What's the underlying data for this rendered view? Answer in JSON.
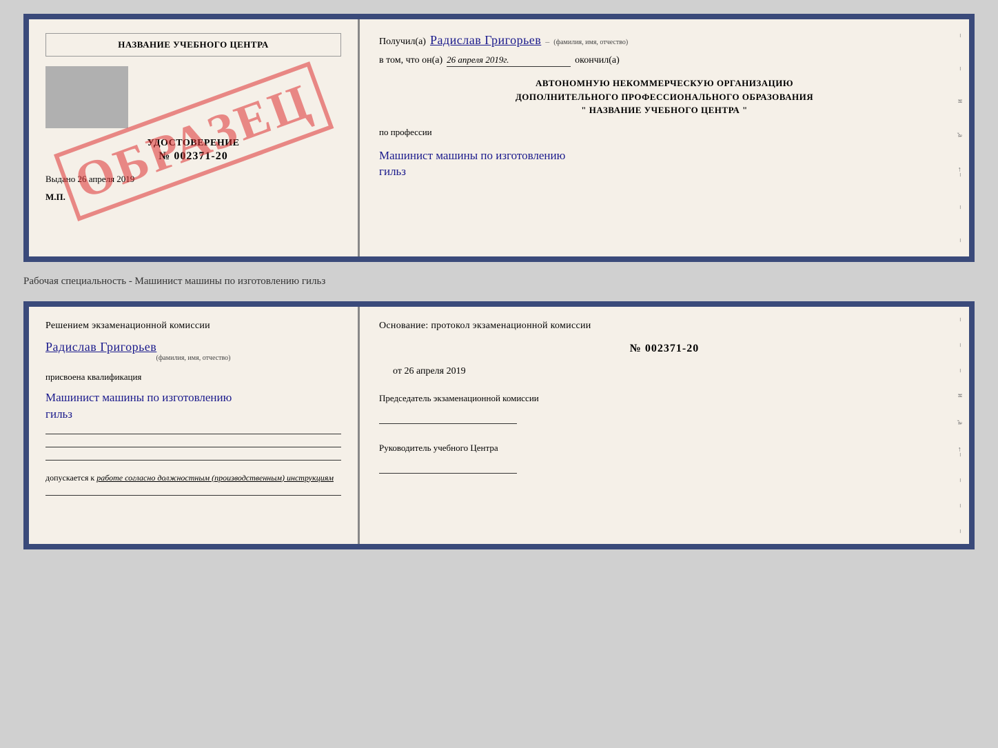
{
  "top_doc": {
    "left": {
      "center_name": "НАЗВАНИЕ УЧЕБНОГО ЦЕНТРА",
      "cert_label": "УДОСТОВЕРЕНИЕ",
      "cert_number": "№ 002371-20",
      "vydano_label": "Выдано",
      "vydano_date": "26 апреля 2019",
      "mp_label": "М.П.",
      "obrazec": "ОБРАЗЕЦ"
    },
    "right": {
      "poluchil_label": "Получил(а)",
      "recipient_name": "Радислав Григорьев",
      "name_sublabel": "(фамилия, имя, отчество)",
      "vtom_label": "в том, что он(а)",
      "completion_date": "26 апреля 2019г.",
      "okonchil_label": "окончил(а)",
      "org_line1": "АВТОНОМНУЮ НЕКОММЕРЧЕСКУЮ ОРГАНИЗАЦИЮ",
      "org_line2": "ДОПОЛНИТЕЛЬНОГО ПРОФЕССИОНАЛЬНОГО ОБРАЗОВАНИЯ",
      "org_quote1": "\"",
      "org_center_name": "НАЗВАНИЕ УЧЕБНОГО ЦЕНТРА",
      "org_quote2": "\"",
      "po_professii_label": "по профессии",
      "profession_line1": "Машинист машины по изготовлению",
      "profession_line2": "гильз"
    }
  },
  "separator_label": "Рабочая специальность - Машинист машины по изготовлению гильз",
  "bottom_doc": {
    "left": {
      "resheniem_label": "Решением  экзаменационной  комиссии",
      "name_label": "Радислав Григорьев",
      "name_sublabel": "(фамилия, имя, отчество)",
      "prisvoyena_label": "присвоена квалификация",
      "qualification_line1": "Машинист машины по изготовлению",
      "qualification_line2": "гильз",
      "dopuskaetsya_prefix": "допускается к",
      "dopuskaetsya_value": "работе согласно должностным (производственным) инструкциям"
    },
    "right": {
      "osnovanie_label": "Основание: протокол экзаменационной  комиссии",
      "protocol_number": "№  002371-20",
      "ot_label": "от",
      "ot_date": "26 апреля 2019",
      "predsedatel_label": "Председатель экзаменационной комиссии",
      "rukovoditel_label": "Руководитель учебного Центра"
    },
    "edge_marks": [
      "и",
      "а",
      "←",
      "",
      "",
      ""
    ]
  }
}
